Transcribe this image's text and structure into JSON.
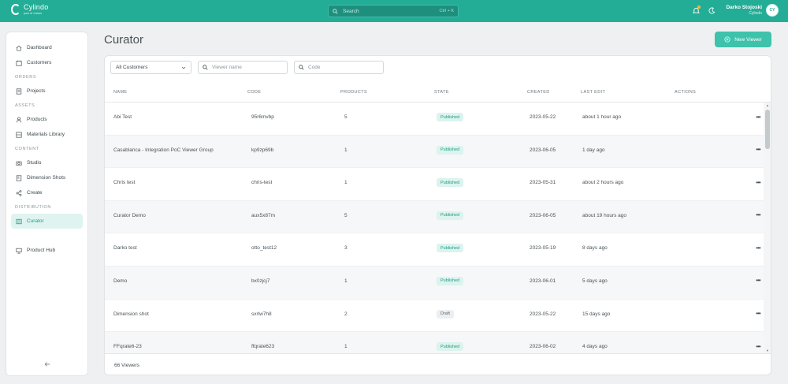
{
  "app": {
    "name": "Cylindo",
    "sub": "part of chaos"
  },
  "search": {
    "placeholder": "Search",
    "shortcut": "Ctrl + K"
  },
  "user": {
    "name": "Darko Stojoski",
    "org": "Cylindo",
    "initials": "CY"
  },
  "sidebar": {
    "items": [
      {
        "label": "Dashboard"
      },
      {
        "label": "Customers"
      },
      {
        "section": "ORDERS"
      },
      {
        "label": "Projects"
      },
      {
        "section": "ASSETS"
      },
      {
        "label": "Products"
      },
      {
        "label": "Materials Library"
      },
      {
        "section": "CONTENT"
      },
      {
        "label": "Studio"
      },
      {
        "label": "Dimension Shots"
      },
      {
        "label": "Create"
      },
      {
        "section": "DISTRIBUTION"
      },
      {
        "label": "Curator"
      },
      {
        "label": "Product Hub"
      }
    ]
  },
  "page": {
    "title": "Curator",
    "new_button": "New Viewer"
  },
  "filters": {
    "customer_select": "All Customers",
    "viewer_placeholder": "Viewer name",
    "code_placeholder": "Code"
  },
  "table": {
    "headers": {
      "name": "NAME",
      "code": "CODE",
      "products": "PRODUCTS",
      "state": "STATE",
      "created": "CREATED",
      "last_edit": "LAST EDIT",
      "actions": "ACTIONS"
    },
    "rows": [
      {
        "name": "Abi Test",
        "code": "95r6mvbp",
        "products": "5",
        "state": "Published",
        "created": "2023-05-22",
        "last_edit": "about 1 hour ago"
      },
      {
        "name": "Casablanca - Integration PoC Viewer Group",
        "code": "kp9zp69b",
        "products": "1",
        "state": "Published",
        "created": "2023-06-05",
        "last_edit": "1 day ago"
      },
      {
        "name": "Chris test",
        "code": "chris-test",
        "products": "1",
        "state": "Published",
        "created": "2023-05-31",
        "last_edit": "about 2 hours ago"
      },
      {
        "name": "Curator Demo",
        "code": "aux5x87m",
        "products": "5",
        "state": "Published",
        "created": "2023-06-05",
        "last_edit": "about 19 hours ago"
      },
      {
        "name": "Darko test",
        "code": "otto_test12",
        "products": "3",
        "state": "Published",
        "created": "2023-05-19",
        "last_edit": "8 days ago"
      },
      {
        "name": "Demo",
        "code": "bx0zjcj7",
        "products": "1",
        "state": "Published",
        "created": "2023-06-01",
        "last_edit": "5 days ago"
      },
      {
        "name": "Dimension shot",
        "code": "sxrlw7h8",
        "products": "2",
        "state": "Draft",
        "created": "2023-05-22",
        "last_edit": "15 days ago"
      },
      {
        "name": "FFqrate6-23",
        "code": "ffqrate623",
        "products": "1",
        "state": "Published",
        "created": "2023-06-02",
        "last_edit": "4 days ago"
      }
    ]
  },
  "footer": {
    "count": "66 Viewers"
  },
  "colors": {
    "brand": "#24ad96",
    "accent": "#3fc2ab",
    "published_bg": "#dcf3ee",
    "draft_bg": "#eceff1"
  },
  "icons": [
    "search-icon",
    "bell-icon",
    "moon-icon",
    "home-icon",
    "users-icon",
    "folder-icon",
    "person-icon",
    "layers-icon",
    "camera-icon",
    "ruler-icon",
    "share-icon",
    "columns-icon",
    "monitor-icon",
    "arrow-left-icon",
    "plus-circle-icon",
    "chevron-down-icon",
    "more-icon"
  ]
}
